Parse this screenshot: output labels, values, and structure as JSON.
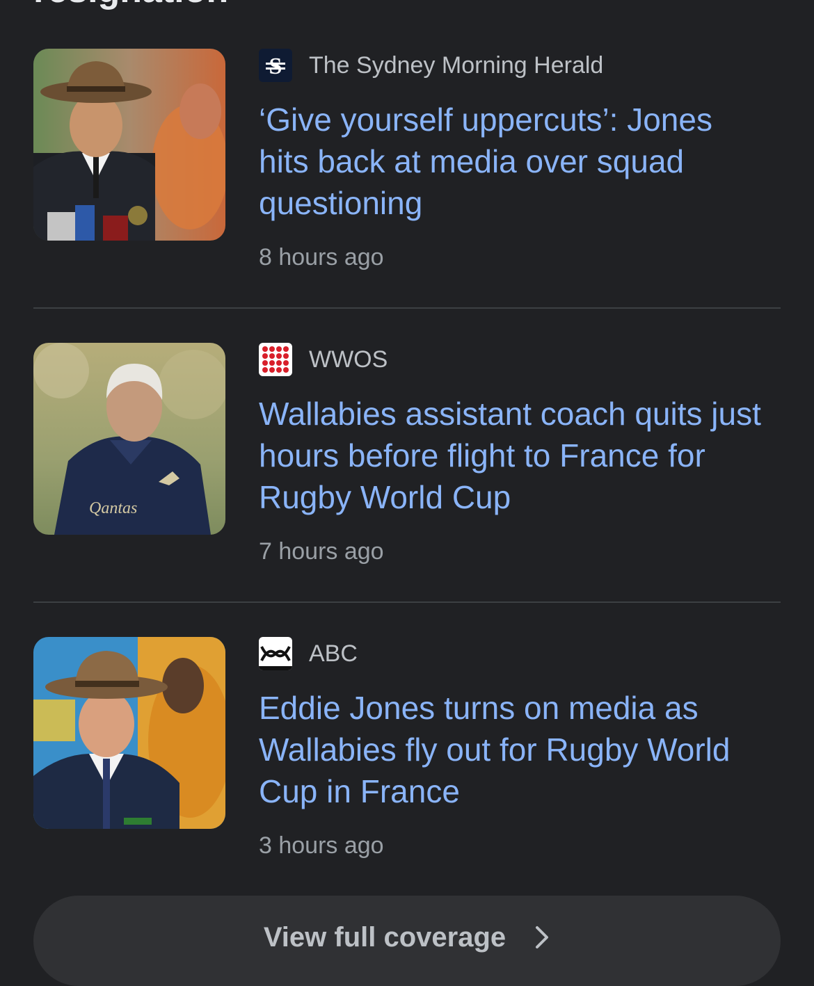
{
  "section": {
    "heading": "resignation"
  },
  "articles": [
    {
      "source": "The Sydney Morning Herald",
      "logo": "smh-logo",
      "headline": "‘Give yourself uppercuts’: Jones hits back at media over squad questioning",
      "time": "8 hours ago",
      "thumbnail": "man-in-hat-at-press-conference"
    },
    {
      "source": "WWOS",
      "logo": "wwos-logo",
      "headline": "Wallabies assistant coach quits just hours before flight to France for Rugby World Cup",
      "time": "7 hours ago",
      "thumbnail": "coach-in-navy-training-top"
    },
    {
      "source": "ABC",
      "logo": "abc-logo",
      "headline": "Eddie Jones turns on media as Wallabies fly out for Rugby World Cup in France",
      "time": "3 hours ago",
      "thumbnail": "man-in-hat-and-suit"
    }
  ],
  "footer": {
    "view_full_coverage": "View full coverage",
    "chevron": "chevron-right-icon"
  },
  "colors": {
    "background": "#202124",
    "headline": "#8ab4f8",
    "source_text": "#bdc1c6",
    "time_text": "#9aa0a6",
    "divider": "#3c4043",
    "button_bg": "#303134"
  }
}
